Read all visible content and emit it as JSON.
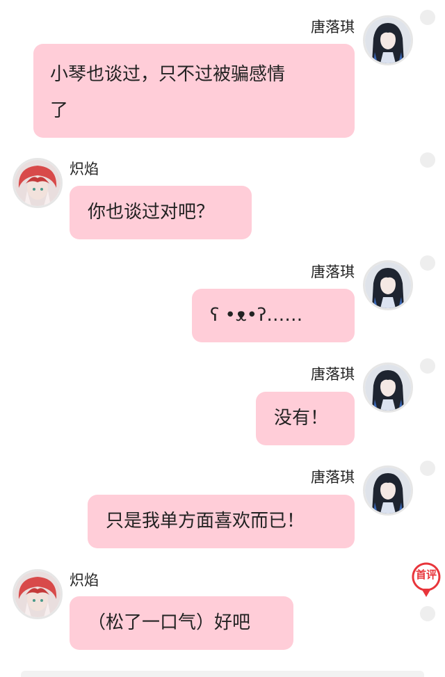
{
  "colors": {
    "bubble": "#ffcdd8",
    "badge": "#e8353b",
    "avatar_border": "#e6e6e6",
    "text": "#222222"
  },
  "messages": [
    {
      "sender": "唐落琪",
      "side": "right",
      "avatar": "girl-dark-hair-avatar",
      "lines": [
        "小琴也谈过，只不过被骗感情",
        "了"
      ]
    },
    {
      "sender": "炽焰",
      "side": "left",
      "avatar": "boy-red-hair-avatar",
      "lines": [
        "你也谈过对吧？"
      ]
    },
    {
      "sender": "唐落琪",
      "side": "right",
      "avatar": "girl-dark-hair-avatar",
      "lines": [
        "ʕ •ᴥ•ʔ……"
      ]
    },
    {
      "sender": "唐落琪",
      "side": "right",
      "avatar": "girl-dark-hair-avatar",
      "lines": [
        "没有！"
      ]
    },
    {
      "sender": "唐落琪",
      "side": "right",
      "avatar": "girl-dark-hair-avatar",
      "lines": [
        "只是我单方面喜欢而已！"
      ]
    },
    {
      "sender": "炽焰",
      "side": "left",
      "avatar": "boy-red-hair-avatar",
      "lines": [
        "（松了一口气）好吧"
      ]
    }
  ],
  "first_comment_badge": {
    "label": "首评",
    "icon": "comment-pin-icon"
  }
}
